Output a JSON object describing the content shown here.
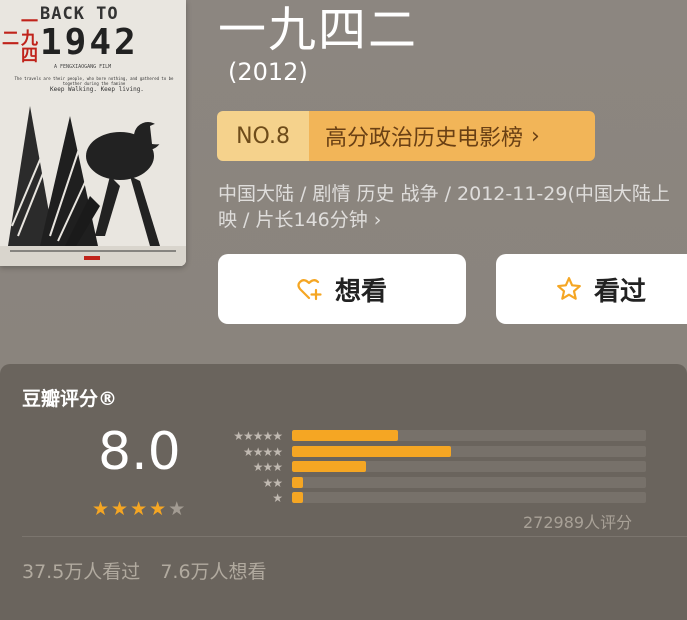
{
  "poster": {
    "red_title": "一九四二",
    "back_to": "BACK TO",
    "year": "1942",
    "subline": "A FENGXIAOGANG FILM",
    "small_text": "The travels are their people, who bore nothing, and gathered to be together during the famine",
    "tagline": "Keep Walking. Keep living."
  },
  "movie": {
    "title": "一九四二",
    "year": "(2012)",
    "rank_no": "NO.8",
    "rank_list": "高分政治历史电影榜",
    "meta": "中国大陆 / 剧情 历史 战争 / 2012-11-29(中国大陆上\n映 / 片长146分钟 ›"
  },
  "buttons": {
    "want": "想看",
    "seen": "看过"
  },
  "rating": {
    "title": "豆瓣评分®",
    "score": "8.0",
    "stars_filled": 4,
    "stars_total": 5,
    "distribution": [
      {
        "stars": 5,
        "label": "★★★★★",
        "pct": 0.3
      },
      {
        "stars": 4,
        "label": "★★★★",
        "pct": 0.45
      },
      {
        "stars": 3,
        "label": "★★★",
        "pct": 0.21
      },
      {
        "stars": 2,
        "label": "★★",
        "pct": 0.03
      },
      {
        "stars": 1,
        "label": "★",
        "pct": 0.03
      }
    ],
    "count": "272989人评分",
    "seen_count": "37.5万人看过",
    "want_count": "7.6万人想看"
  },
  "colors": {
    "accent": "#f5a623",
    "rank_left": "#f5d28c",
    "rank_right": "#f2b558",
    "background": "#8a847d",
    "panel": "#6a645d"
  }
}
